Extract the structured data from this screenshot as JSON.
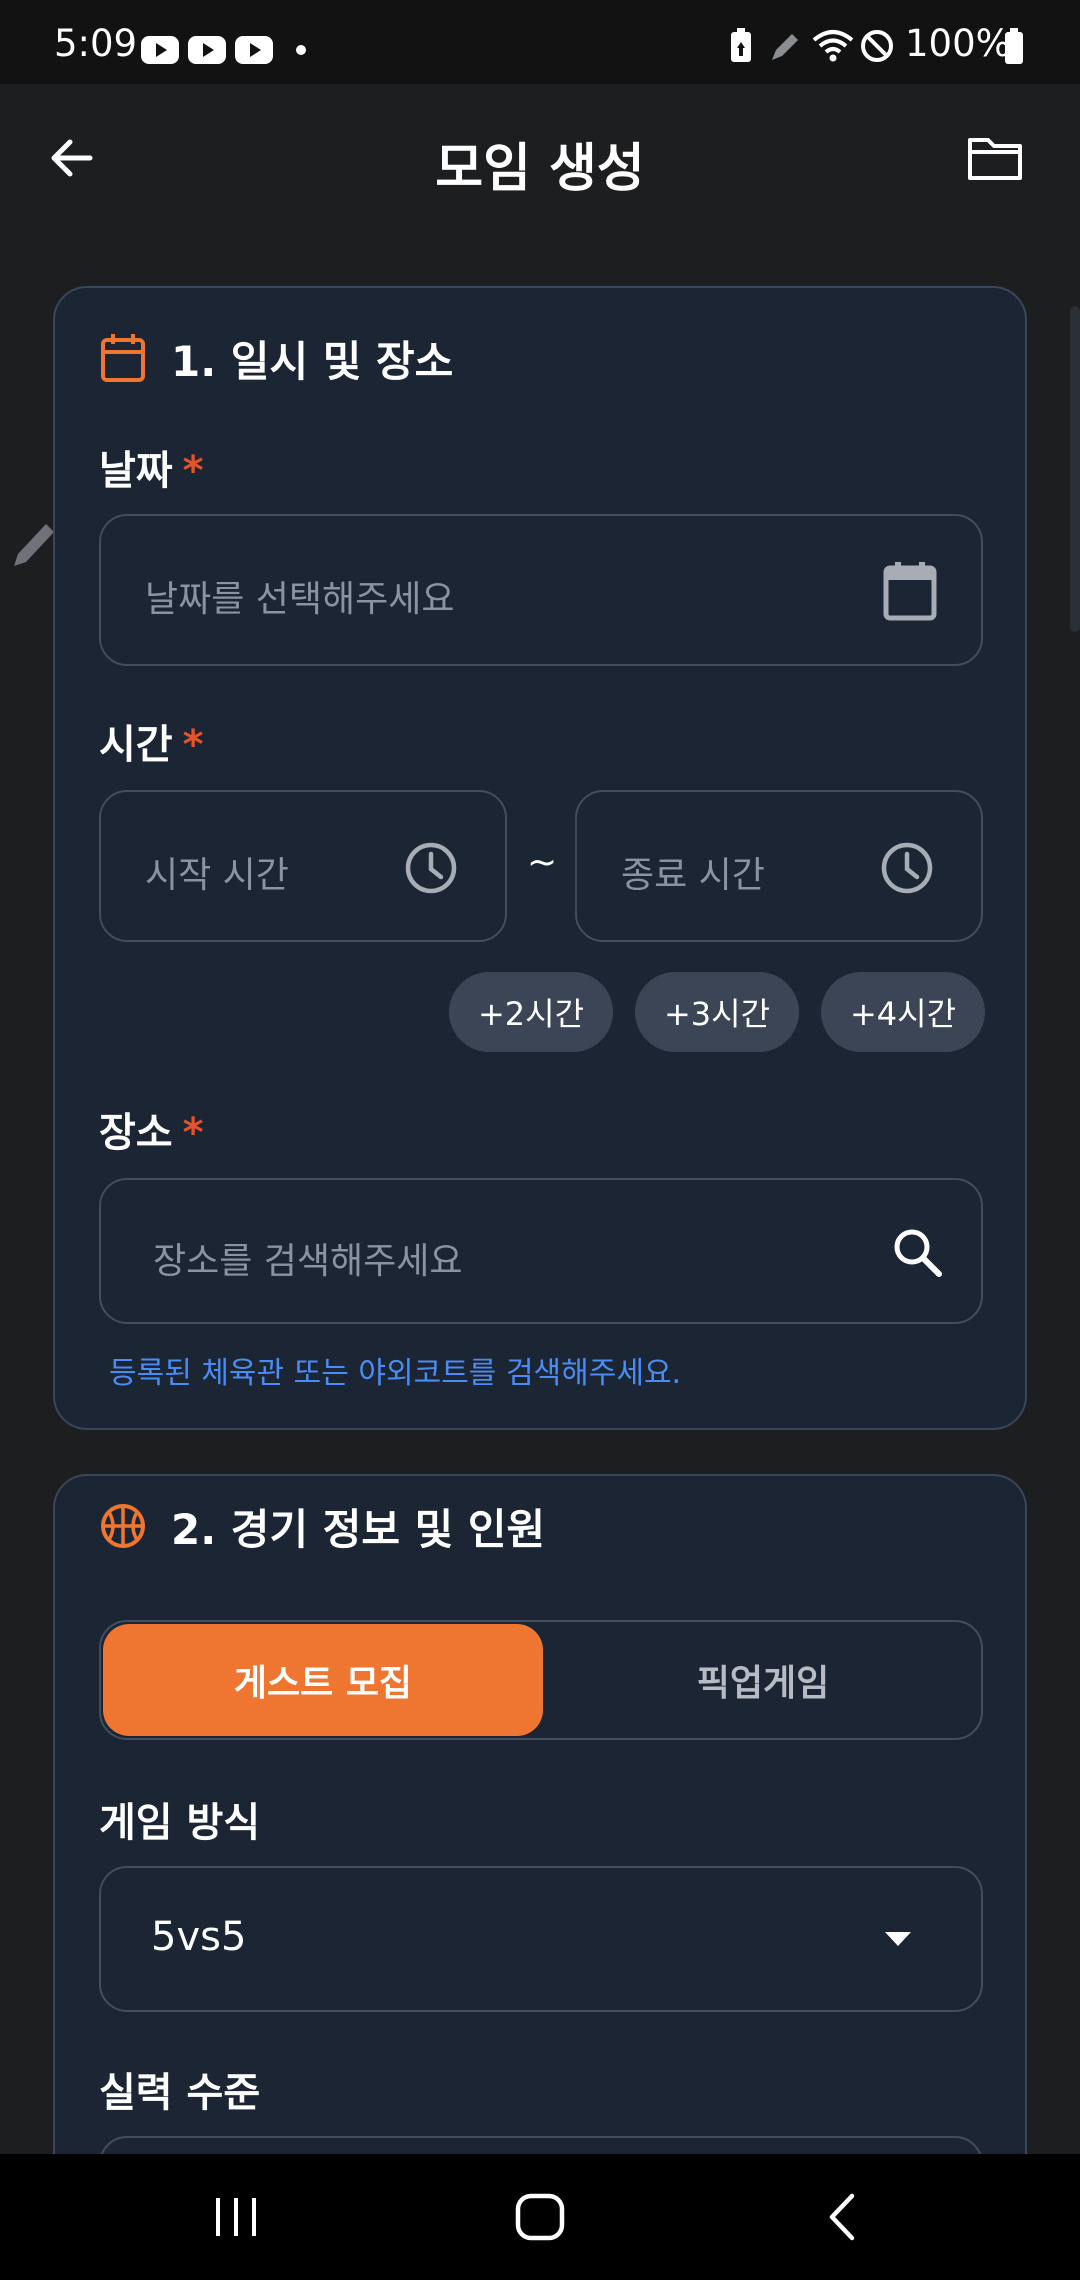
{
  "status_bar": {
    "time": "5:09",
    "battery": "100%",
    "icons": [
      "youtube-icon",
      "youtube-icon",
      "youtube-icon",
      "dot-icon",
      "battery-saver-icon",
      "pen-icon",
      "wifi-icon",
      "do-not-disturb-icon",
      "battery-icon"
    ]
  },
  "app_bar": {
    "title": "모임 생성",
    "back_icon": "arrow-left-icon",
    "folder_icon": "folder-icon"
  },
  "section1": {
    "title": "1. 일시 및 장소",
    "icon": "calendar-icon",
    "date": {
      "label": "날짜",
      "required": "*",
      "placeholder": "날짜를 선택해주세요"
    },
    "time": {
      "label": "시간",
      "required": "*",
      "start_placeholder": "시작 시간",
      "separator": "~",
      "end_placeholder": "종료 시간",
      "quick_buttons": [
        "+2시간",
        "+3시간",
        "+4시간"
      ]
    },
    "place": {
      "label": "장소",
      "required": "*",
      "placeholder": "장소를 검색해주세요",
      "hint": "등록된 체육관 또는 야외코트를 검색해주세요."
    }
  },
  "section2": {
    "title": "2. 경기 정보 및 인원",
    "icon": "basketball-icon",
    "mode_tabs": {
      "active": "게스트 모집",
      "inactive": "픽업게임"
    },
    "game_type": {
      "label": "게임 방식",
      "value": "5vs5"
    },
    "skill_level": {
      "label": "실력 수준"
    }
  },
  "colors": {
    "accent": "#ef7630",
    "card_bg": "#1c2533",
    "required": "#e4542c",
    "hint": "#4a8cf5"
  }
}
